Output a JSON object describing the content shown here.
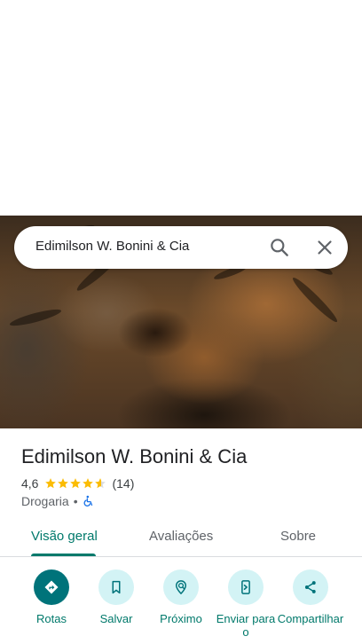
{
  "search": {
    "query": "Edimilson W. Bonini & Cia"
  },
  "place": {
    "name": "Edimilson W. Bonini & Cia",
    "rating": "4,6",
    "rating_value": 4.6,
    "review_count": "(14)",
    "category": "Drogaria",
    "separator": "•"
  },
  "tabs": [
    {
      "label": "Visão geral",
      "selected": true
    },
    {
      "label": "Avaliações",
      "selected": false
    },
    {
      "label": "Sobre",
      "selected": false
    }
  ],
  "actions": [
    {
      "label": "Rotas",
      "icon": "directions-icon"
    },
    {
      "label": "Salvar",
      "icon": "bookmark-icon"
    },
    {
      "label": "Próximo",
      "icon": "nearby-icon"
    },
    {
      "label": "Enviar para o",
      "icon": "send-to-phone-icon"
    },
    {
      "label": "Compartilhar",
      "icon": "share-icon"
    }
  ],
  "colors": {
    "accent": "#00796b",
    "primary_action": "#00737a",
    "action_bg": "#d3f3f5",
    "star": "#fbbc04",
    "accessibility": "#1a73e8"
  }
}
